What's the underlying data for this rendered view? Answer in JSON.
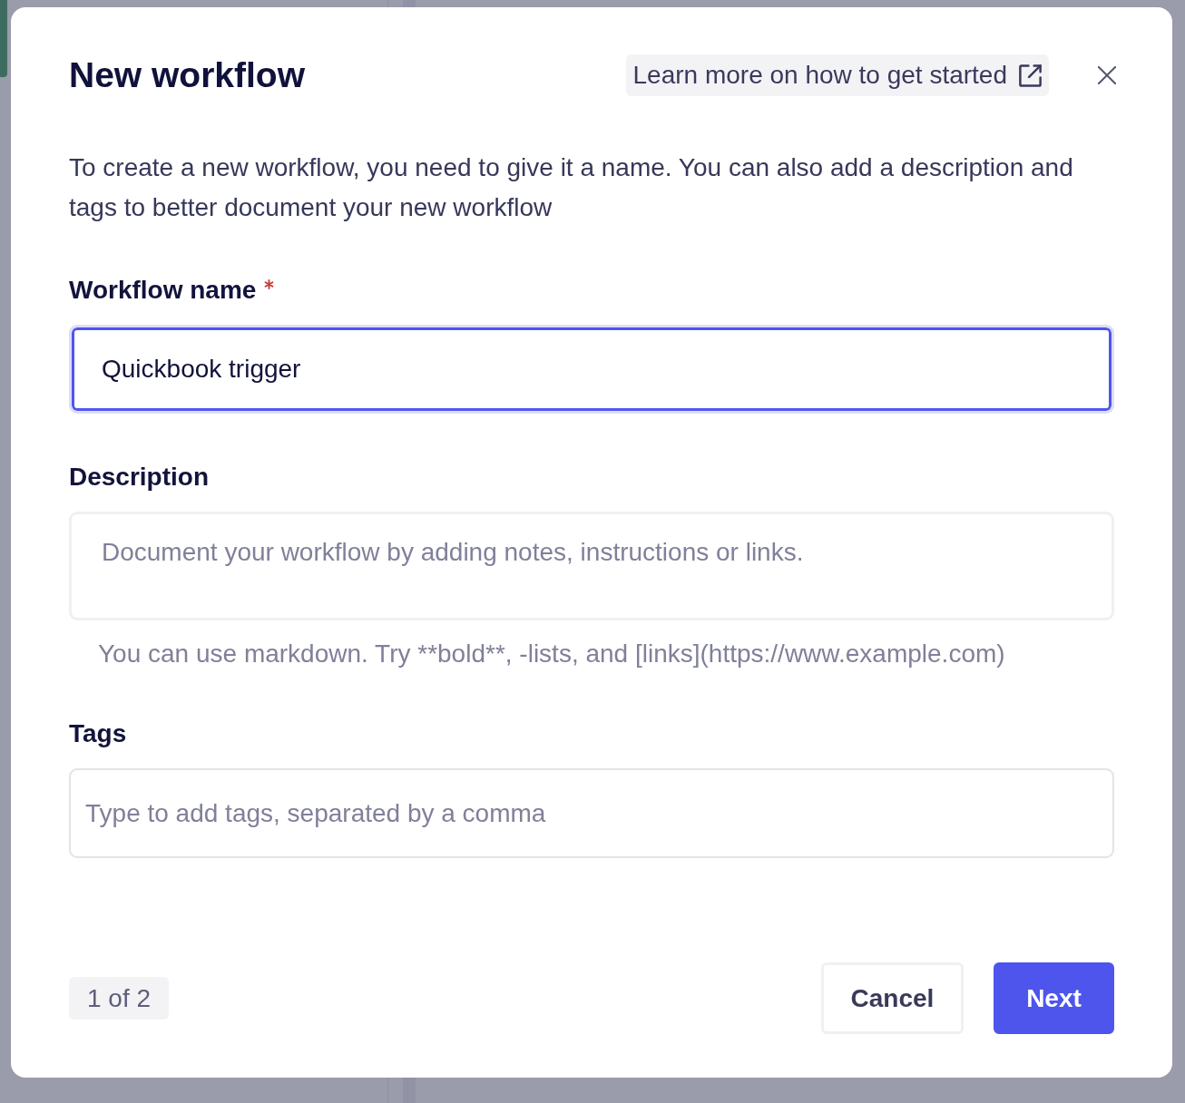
{
  "dialog": {
    "title": "New workflow",
    "help_link": {
      "label": "Learn more on how to get started"
    },
    "intro": "To create a new workflow, you need to give it a name. You can also add a description and tags to better document your new workflow",
    "fields": [
      {
        "kind": "text",
        "label": "Workflow name",
        "required": true,
        "focused": true,
        "value": "Quickbook trigger"
      },
      {
        "kind": "textarea",
        "label": "Description",
        "required": false,
        "focused": false,
        "placeholder": "Document your workflow by adding notes, instructions or links.",
        "hint": "You can use markdown. Try **bold**, -lists, and [links](https://www.example.com)"
      },
      {
        "kind": "tags",
        "label": "Tags",
        "required": false,
        "focused": false,
        "placeholder": "Type to add tags, separated by a comma"
      }
    ],
    "step": "1 of 2",
    "buttons": [
      {
        "kind": "secondary",
        "label": "Cancel"
      },
      {
        "kind": "primary",
        "label": "Next"
      }
    ]
  }
}
